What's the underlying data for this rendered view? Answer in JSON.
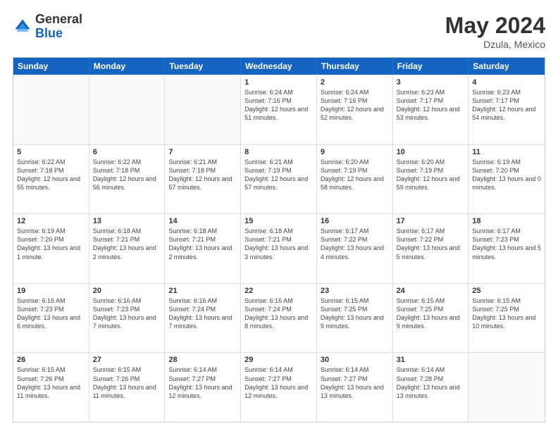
{
  "header": {
    "logo_general": "General",
    "logo_blue": "Blue",
    "month_year": "May 2024",
    "location": "Dzula, Mexico"
  },
  "days_of_week": [
    "Sunday",
    "Monday",
    "Tuesday",
    "Wednesday",
    "Thursday",
    "Friday",
    "Saturday"
  ],
  "weeks": [
    [
      {
        "day": "",
        "info": "",
        "empty": true
      },
      {
        "day": "",
        "info": "",
        "empty": true
      },
      {
        "day": "",
        "info": "",
        "empty": true
      },
      {
        "day": "1",
        "info": "Sunrise: 6:24 AM\nSunset: 7:16 PM\nDaylight: 12 hours\nand 51 minutes."
      },
      {
        "day": "2",
        "info": "Sunrise: 6:24 AM\nSunset: 7:16 PM\nDaylight: 12 hours\nand 52 minutes."
      },
      {
        "day": "3",
        "info": "Sunrise: 6:23 AM\nSunset: 7:17 PM\nDaylight: 12 hours\nand 53 minutes."
      },
      {
        "day": "4",
        "info": "Sunrise: 6:23 AM\nSunset: 7:17 PM\nDaylight: 12 hours\nand 54 minutes."
      }
    ],
    [
      {
        "day": "5",
        "info": "Sunrise: 6:22 AM\nSunset: 7:18 PM\nDaylight: 12 hours\nand 55 minutes."
      },
      {
        "day": "6",
        "info": "Sunrise: 6:22 AM\nSunset: 7:18 PM\nDaylight: 12 hours\nand 56 minutes."
      },
      {
        "day": "7",
        "info": "Sunrise: 6:21 AM\nSunset: 7:18 PM\nDaylight: 12 hours\nand 57 minutes."
      },
      {
        "day": "8",
        "info": "Sunrise: 6:21 AM\nSunset: 7:19 PM\nDaylight: 12 hours\nand 57 minutes."
      },
      {
        "day": "9",
        "info": "Sunrise: 6:20 AM\nSunset: 7:19 PM\nDaylight: 12 hours\nand 58 minutes."
      },
      {
        "day": "10",
        "info": "Sunrise: 6:20 AM\nSunset: 7:19 PM\nDaylight: 12 hours\nand 59 minutes."
      },
      {
        "day": "11",
        "info": "Sunrise: 6:19 AM\nSunset: 7:20 PM\nDaylight: 13 hours\nand 0 minutes."
      }
    ],
    [
      {
        "day": "12",
        "info": "Sunrise: 6:19 AM\nSunset: 7:20 PM\nDaylight: 13 hours\nand 1 minute."
      },
      {
        "day": "13",
        "info": "Sunrise: 6:18 AM\nSunset: 7:21 PM\nDaylight: 13 hours\nand 2 minutes."
      },
      {
        "day": "14",
        "info": "Sunrise: 6:18 AM\nSunset: 7:21 PM\nDaylight: 13 hours\nand 2 minutes."
      },
      {
        "day": "15",
        "info": "Sunrise: 6:18 AM\nSunset: 7:21 PM\nDaylight: 13 hours\nand 3 minutes."
      },
      {
        "day": "16",
        "info": "Sunrise: 6:17 AM\nSunset: 7:22 PM\nDaylight: 13 hours\nand 4 minutes."
      },
      {
        "day": "17",
        "info": "Sunrise: 6:17 AM\nSunset: 7:22 PM\nDaylight: 13 hours\nand 5 minutes."
      },
      {
        "day": "18",
        "info": "Sunrise: 6:17 AM\nSunset: 7:23 PM\nDaylight: 13 hours\nand 5 minutes."
      }
    ],
    [
      {
        "day": "19",
        "info": "Sunrise: 6:16 AM\nSunset: 7:23 PM\nDaylight: 13 hours\nand 6 minutes."
      },
      {
        "day": "20",
        "info": "Sunrise: 6:16 AM\nSunset: 7:23 PM\nDaylight: 13 hours\nand 7 minutes."
      },
      {
        "day": "21",
        "info": "Sunrise: 6:16 AM\nSunset: 7:24 PM\nDaylight: 13 hours\nand 7 minutes."
      },
      {
        "day": "22",
        "info": "Sunrise: 6:16 AM\nSunset: 7:24 PM\nDaylight: 13 hours\nand 8 minutes."
      },
      {
        "day": "23",
        "info": "Sunrise: 6:15 AM\nSunset: 7:25 PM\nDaylight: 13 hours\nand 9 minutes."
      },
      {
        "day": "24",
        "info": "Sunrise: 6:15 AM\nSunset: 7:25 PM\nDaylight: 13 hours\nand 9 minutes."
      },
      {
        "day": "25",
        "info": "Sunrise: 6:15 AM\nSunset: 7:25 PM\nDaylight: 13 hours\nand 10 minutes."
      }
    ],
    [
      {
        "day": "26",
        "info": "Sunrise: 6:15 AM\nSunset: 7:26 PM\nDaylight: 13 hours\nand 11 minutes."
      },
      {
        "day": "27",
        "info": "Sunrise: 6:15 AM\nSunset: 7:26 PM\nDaylight: 13 hours\nand 11 minutes."
      },
      {
        "day": "28",
        "info": "Sunrise: 6:14 AM\nSunset: 7:27 PM\nDaylight: 13 hours\nand 12 minutes."
      },
      {
        "day": "29",
        "info": "Sunrise: 6:14 AM\nSunset: 7:27 PM\nDaylight: 13 hours\nand 12 minutes."
      },
      {
        "day": "30",
        "info": "Sunrise: 6:14 AM\nSunset: 7:27 PM\nDaylight: 13 hours\nand 13 minutes."
      },
      {
        "day": "31",
        "info": "Sunrise: 6:14 AM\nSunset: 7:28 PM\nDaylight: 13 hours\nand 13 minutes."
      },
      {
        "day": "",
        "info": "",
        "empty": true
      }
    ]
  ]
}
